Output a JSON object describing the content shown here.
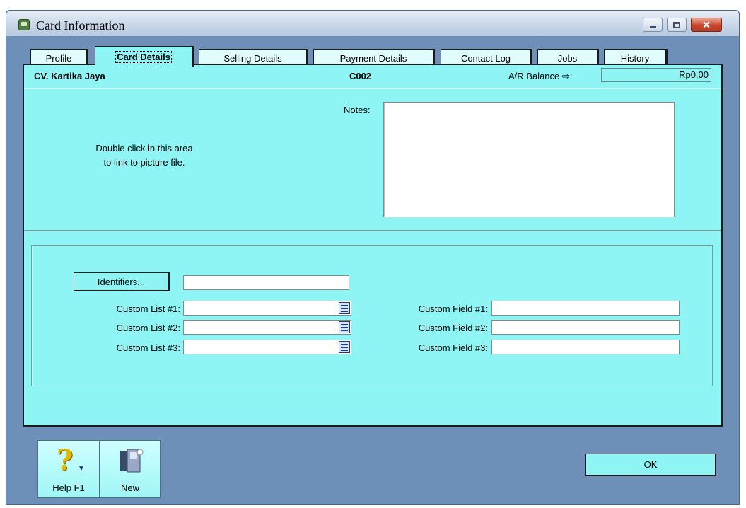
{
  "window": {
    "title": "Card Information",
    "controls": {
      "minimize_icon": "minimize-icon",
      "maximize_icon": "maximize-icon",
      "close_label": "✕"
    }
  },
  "tabs": [
    {
      "label": "Profile"
    },
    {
      "label": "Card Details",
      "active": true
    },
    {
      "label": "Selling Details"
    },
    {
      "label": "Payment Details"
    },
    {
      "label": "Contact Log"
    },
    {
      "label": "Jobs"
    },
    {
      "label": "History"
    }
  ],
  "header": {
    "name": "CV. Kartika Jaya",
    "code": "C002",
    "ar_label": "A/R Balance ⇨:",
    "ar_value": "Rp0,00"
  },
  "picture_area": {
    "line1": "Double click in this area",
    "line2": "to link to picture file."
  },
  "notes": {
    "label": "Notes:",
    "value": ""
  },
  "identifiers": {
    "button_label": "Identifiers...",
    "value": ""
  },
  "custom_lists": [
    {
      "label": "Custom List #1:",
      "value": ""
    },
    {
      "label": "Custom List #2:",
      "value": ""
    },
    {
      "label": "Custom List #3:",
      "value": ""
    }
  ],
  "custom_fields": [
    {
      "label": "Custom Field #1:",
      "value": ""
    },
    {
      "label": "Custom Field #2:",
      "value": ""
    },
    {
      "label": "Custom Field #3:",
      "value": ""
    }
  ],
  "toolbar": {
    "help_label": "Help F1",
    "new_label": "New",
    "ok_label": "OK"
  },
  "colors": {
    "panel": "#8ff4f4",
    "window_bg": "#6d8fb8",
    "help_icon": "#e0b800"
  }
}
